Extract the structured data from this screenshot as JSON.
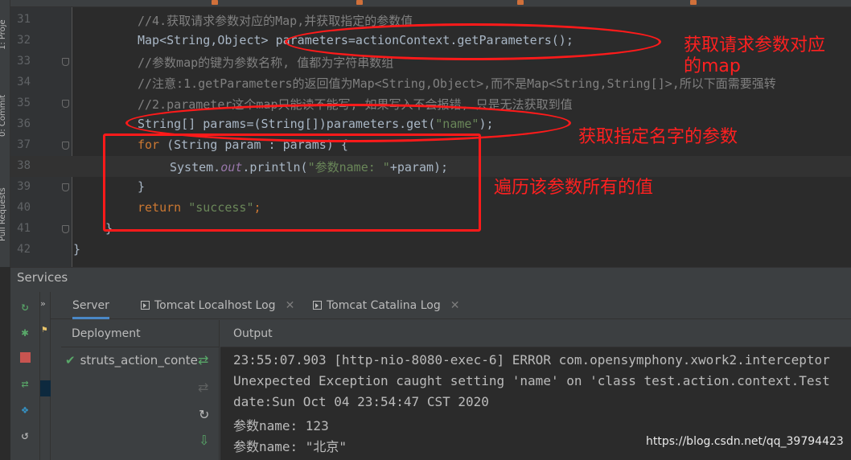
{
  "stripe": {
    "project_tab": "1: Proje",
    "commit_tab": "0: Commit",
    "pr_tab": "Pull Requests"
  },
  "editor": {
    "lines": [
      {
        "num": "31",
        "text": "//4.获取请求参数对应的Map,并获取指定的参数值"
      },
      {
        "num": "32",
        "text": "Map<String,Object> parameters=actionContext.getParameters();"
      },
      {
        "num": "33",
        "text": "//参数map的键为参数名称, 值都为字符串数组"
      },
      {
        "num": "34",
        "text": "//注意:1.getParameters的返回值为Map<String,Object>,而不是Map<String,String[]>,所以下面需要强转"
      },
      {
        "num": "35",
        "text": "//2.parameter这个map只能读不能写, 如果写入不会报错, 只是无法获取到值"
      },
      {
        "num": "36",
        "code_a": "String[] params=(String[])parameters.get(",
        "code_str": "\"name\"",
        "code_b": ");"
      },
      {
        "num": "37",
        "kw": "for",
        "code": " (String param : params) {"
      },
      {
        "num": "38",
        "code_a": "System.",
        "field": "out",
        "code_b": ".println(",
        "code_str": "\"参数name: \"",
        "code_c": "+param);"
      },
      {
        "num": "39",
        "text": "}"
      },
      {
        "num": "40",
        "kw": "return",
        "code_str": " \"success\"",
        "code_b": ";"
      },
      {
        "num": "41",
        "text": "}"
      },
      {
        "num": "42",
        "text": "}"
      }
    ]
  },
  "annotations": {
    "note1": "获取请求参数对应\n的map",
    "note2": "获取指定名字的参数",
    "note3": "遍历该参数所有的值",
    "color": "#ff1a1a"
  },
  "services": {
    "title": "Services",
    "tabs": [
      "Server",
      "Tomcat Localhost Log",
      "Tomcat Catalina Log"
    ],
    "deployment_label": "Deployment",
    "deployment_item": "struts_action_conte",
    "output_label": "Output",
    "output_lines": [
      "23:55:07.903 [http-nio-8080-exec-6] ERROR com.opensymphony.xwork2.interceptor",
      "Unexpected Exception caught setting 'name' on 'class test.action.context.Test",
      "date:Sun Oct 04 23:54:47 CST 2020",
      "参数name: 123",
      "参数name: \"北京\""
    ]
  },
  "watermark": "https://blog.csdn.net/qq_39794423",
  "colors": {
    "background": "#2b2b2b",
    "comment": "#808080",
    "keyword": "#cc7832",
    "string": "#6a8759",
    "run_green": "#59a869",
    "stop_red": "#c75450"
  }
}
